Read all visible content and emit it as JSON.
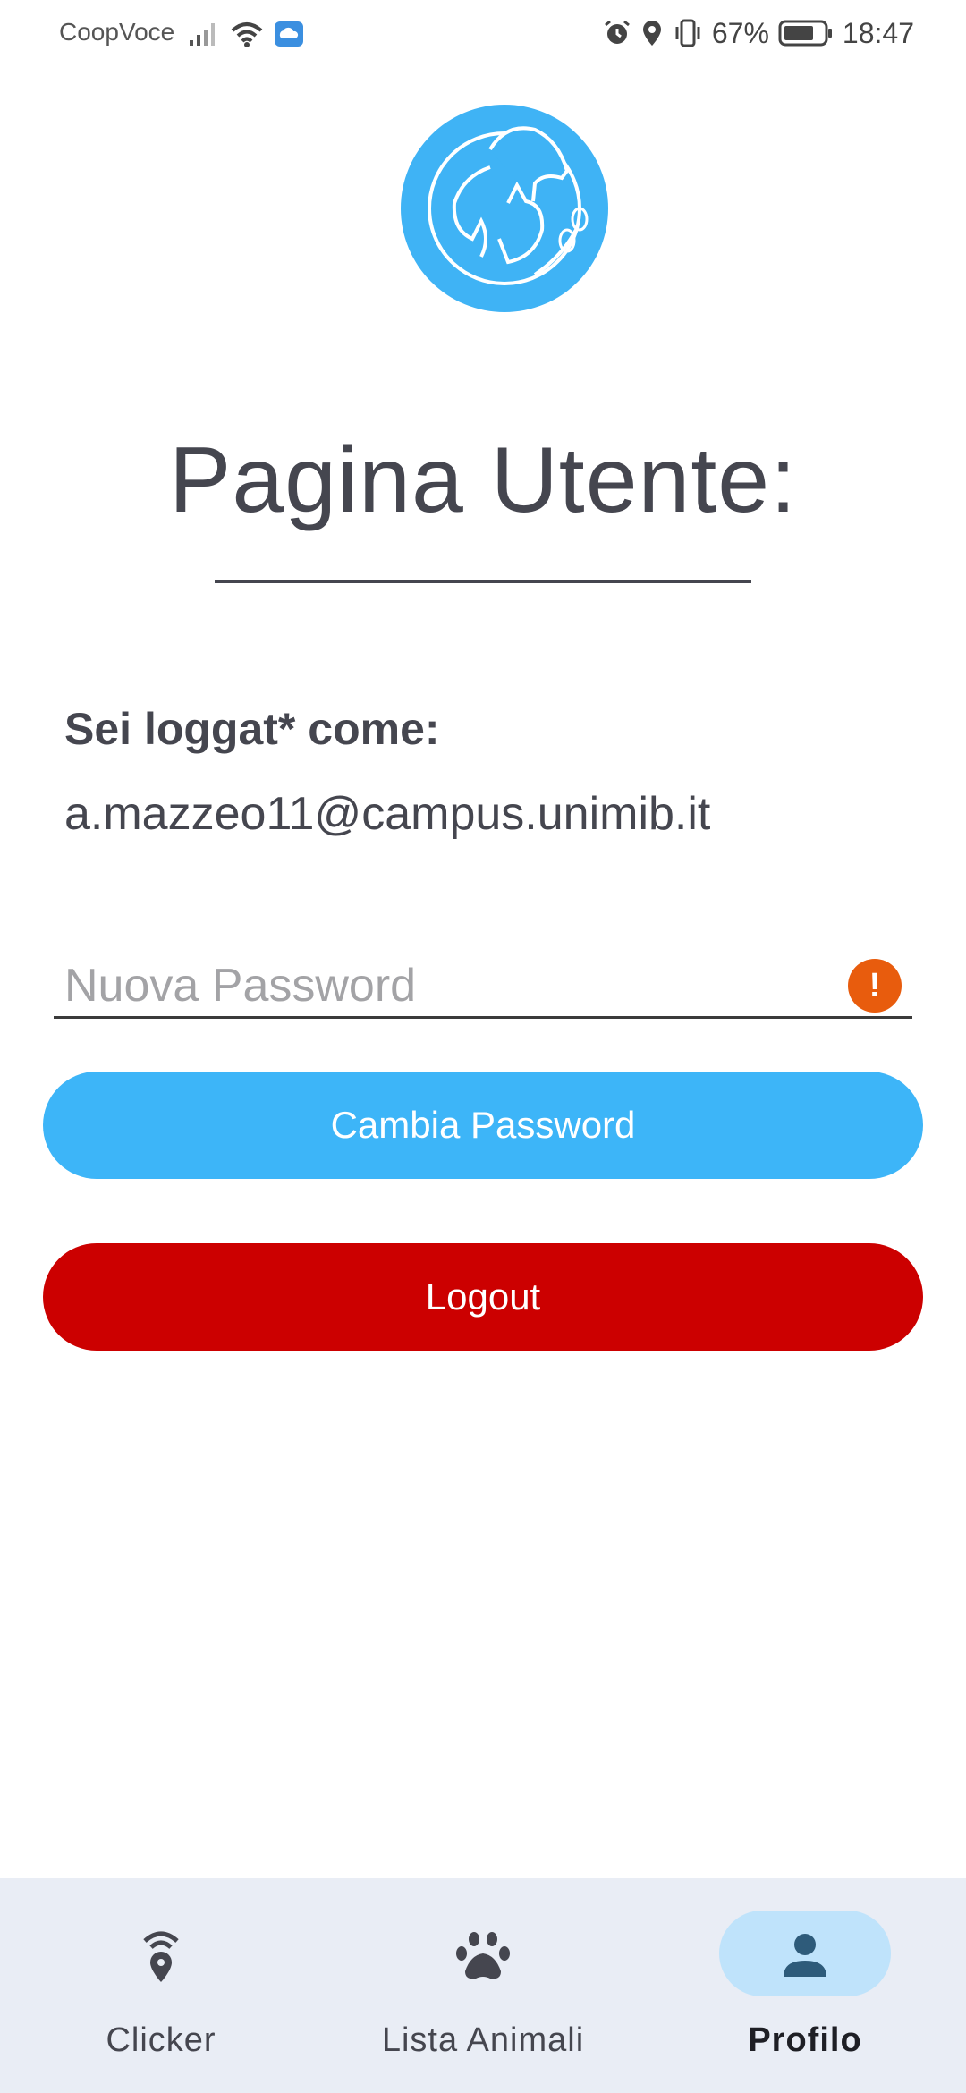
{
  "status_bar": {
    "carrier": "CoopVoce",
    "battery": "67%",
    "time": "18:47"
  },
  "page": {
    "title": "Pagina Utente:",
    "login_label": "Sei loggat* come:",
    "login_email": "a.mazzeo11@campus.unimib.it"
  },
  "form": {
    "new_password_placeholder": "Nuova Password",
    "error_glyph": "!",
    "change_password_label": "Cambia Password",
    "logout_label": "Logout"
  },
  "colors": {
    "primary": "#3db5f8",
    "danger": "#cc0000",
    "error": "#e85c0d",
    "nav_bg": "#e9edf5",
    "nav_active_pill": "#bfe3fb"
  },
  "bottom_nav": {
    "items": [
      {
        "label": "Clicker",
        "icon": "wireless-location-icon",
        "active": false
      },
      {
        "label": "Lista Animali",
        "icon": "paw-icon",
        "active": false
      },
      {
        "label": "Profilo",
        "icon": "person-icon",
        "active": true
      }
    ]
  }
}
